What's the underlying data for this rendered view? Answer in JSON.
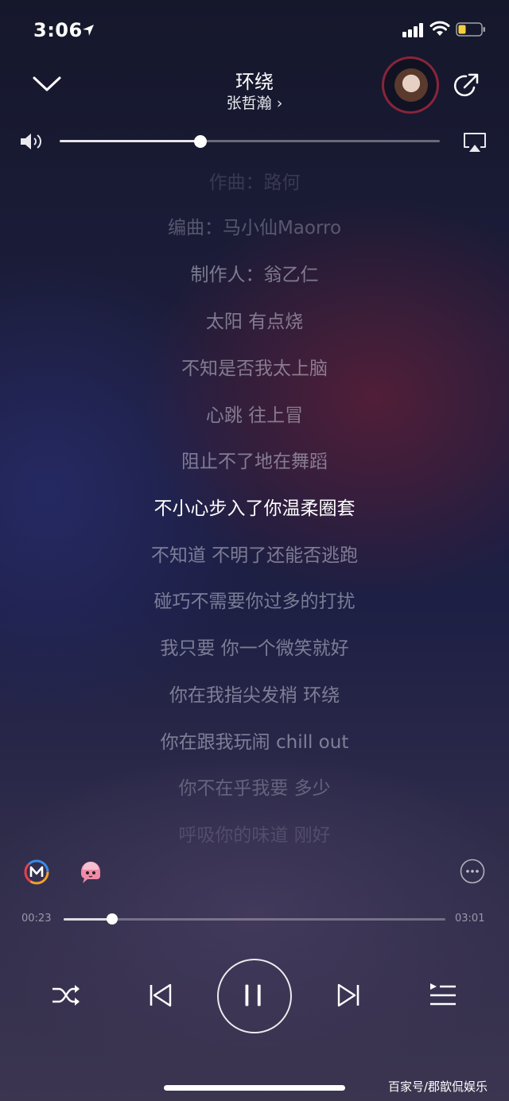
{
  "status_bar": {
    "time": "3:06",
    "battery_color": "#f4d03f"
  },
  "header": {
    "title": "环绕",
    "artist": "张哲瀚"
  },
  "volume": {
    "level": 0.37
  },
  "lyrics": [
    "作曲：路何",
    "编曲：马小仙Maorro",
    "制作人：翁乙仁",
    "太阳 有点烧",
    "不知是否我太上脑",
    "心跳 往上冒",
    "阻止不了地在舞蹈",
    "不小心步入了你温柔圈套",
    "不知道 不明了还能否逃跑",
    "碰巧不需要你过多的打扰",
    "我只要 你一个微笑就好",
    "你在我指尖发梢 环绕",
    "你在跟我玩闹 chill out",
    "你不在乎我要 多少",
    "呼吸你的味道 刚好"
  ],
  "current_lyric_index": 7,
  "progress": {
    "current": "00:23",
    "total": "03:01",
    "fraction": 0.127
  },
  "icons": {
    "collapse": "chevron-down-icon",
    "share": "share-icon",
    "volume": "speaker-icon",
    "airplay": "airplay-icon",
    "more": "more-icon",
    "shuffle": "shuffle-icon",
    "prev": "previous-icon",
    "play": "pause-icon",
    "next": "next-icon",
    "playlist": "playlist-icon"
  },
  "watermark": "百家号/郡歆侃娱乐"
}
